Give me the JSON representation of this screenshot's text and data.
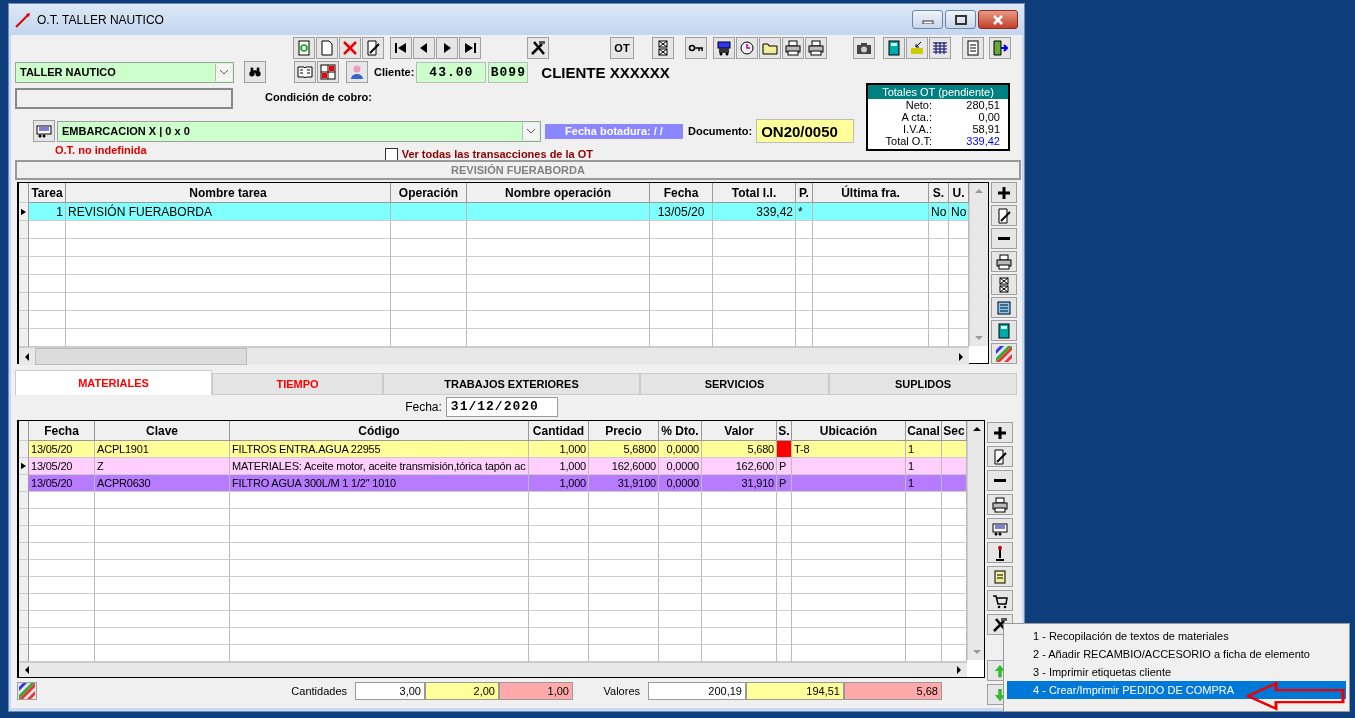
{
  "window": {
    "title": "O.T. TALLER NAUTICO"
  },
  "toolbar": {
    "ot_button": "OT"
  },
  "taller": {
    "value": "TALLER NAUTICO"
  },
  "cliente": {
    "label": "Cliente:",
    "code": "43.00",
    "ref": "B099",
    "name": "CLIENTE XXXXXX"
  },
  "condicion": {
    "label": "Condición de cobro:"
  },
  "embarcacion": {
    "value": "EMBARCACION X | 0 x 0",
    "warning": "O.T. no indefinida"
  },
  "fecha_botadura": {
    "label": "Fecha botadura:",
    "value": "/ /"
  },
  "documento": {
    "label": "Documento:",
    "value": "ON20/0050"
  },
  "ver_todas": {
    "label": "Ver todas las transacciones de la OT",
    "checked": false
  },
  "totales": {
    "title": "Totales OT (pendiente)",
    "rows": [
      {
        "label": "Neto:",
        "value": "280,51",
        "kind": "normal"
      },
      {
        "label": "A cta.:",
        "value": "0,00",
        "kind": "normal"
      },
      {
        "label": "I.V.A.:",
        "value": "58,91",
        "kind": "normal"
      },
      {
        "label": "Total O.T:",
        "value": "339,42",
        "kind": "total"
      }
    ]
  },
  "section_title": "REVISIÓN FUERABORDA",
  "tasks": {
    "columns": [
      "Tarea",
      "Nombre tarea",
      "Operación",
      "Nombre operación",
      "Fecha",
      "Total I.I.",
      "P.",
      "Última fra.",
      "S.",
      "U."
    ],
    "rows": [
      {
        "cells": [
          "1",
          "REVISIÓN FUERABORDA",
          "",
          "",
          "13/05/20",
          "339,42",
          "*",
          "",
          "No",
          "No"
        ],
        "selected": true
      }
    ]
  },
  "tabs": [
    {
      "label": "MATERIALES",
      "color": "#ff0000",
      "selected": true
    },
    {
      "label": "TIEMPO",
      "color": "#ff0000",
      "selected": false
    },
    {
      "label": "TRABAJOS EXTERIORES",
      "color": "#000000",
      "selected": false
    },
    {
      "label": "SERVICIOS",
      "color": "#000000",
      "selected": false
    },
    {
      "label": "SUPLIDOS",
      "color": "#000000",
      "selected": false
    }
  ],
  "fecha": {
    "label": "Fecha:",
    "value": "31/12/2020"
  },
  "materials": {
    "columns": [
      "Fecha",
      "Clave",
      "Código",
      "Cantidad",
      "Precio",
      "% Dto.",
      "Valor",
      "S.",
      "Ubicación",
      "Canal",
      "Sec"
    ],
    "rows": [
      {
        "cells": [
          "13/05/20",
          "ACPL1901",
          "FILTROS ENTRA.AGUA  22955",
          "1,000",
          "5,6800",
          "0,0000",
          "5,680",
          "",
          "T-8",
          "1",
          ""
        ],
        "color": "#ffff99",
        "flag": true,
        "selected": false
      },
      {
        "cells": [
          "13/05/20",
          "Z",
          "MATERIALES: Aceite motor, aceite transmisión,tórica tapón ac",
          "1,000",
          "162,6000",
          "0,0000",
          "162,600",
          "P",
          "",
          "1",
          ""
        ],
        "color": "#ffd0ff",
        "flag": false,
        "selected": true
      },
      {
        "cells": [
          "13/05/20",
          "ACPR0630",
          "FILTRO AGUA 300L/M 1 1/2\" 1010",
          "1,000",
          "31,9100",
          "0,0000",
          "31,910",
          "P",
          "",
          "1",
          ""
        ],
        "color": "#b77bff",
        "flag": false,
        "selected": false
      }
    ]
  },
  "footer": {
    "cantidades_label": "Cantidades",
    "cantidades": [
      "3,00",
      "2,00",
      "1,00"
    ],
    "valores_label": "Valores",
    "valores": [
      "200,19",
      "194,51",
      "5,68"
    ]
  },
  "context_menu": [
    {
      "label": "1 - Recopilación de textos de materiales",
      "selected": false
    },
    {
      "label": "2 - Añadir RECAMBIO/ACCESORIO a ficha de elemento",
      "selected": false
    },
    {
      "label": "3 - Imprimir etiquetas cliente",
      "selected": false
    },
    {
      "label": "4 - Crear/Imprimir PEDIDO DE COMPRA",
      "selected": true
    }
  ]
}
